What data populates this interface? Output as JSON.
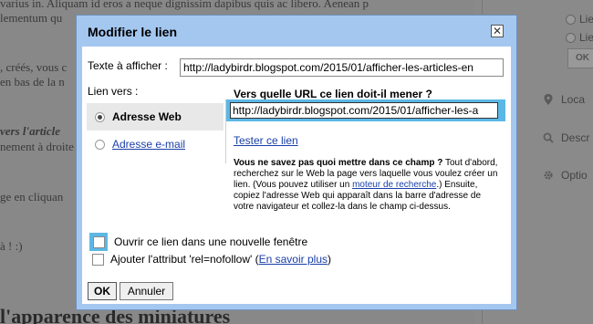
{
  "background": {
    "lines": [
      "varius in. Aliquam id eros a neque dignissim dapibus quis ac libero. Aenean p",
      "lementum qu",
      ", créés, vous c",
      "en bas de la n",
      "vers l'article",
      "nement à droite",
      "ge en cliquan",
      "à ! :)"
    ],
    "heading": "l'apparence des miniatures",
    "sidebar": {
      "radio_1": "Lie",
      "radio_2": "Lie",
      "ok": "OK",
      "items": [
        {
          "icon": "location-icon",
          "label": "Loca"
        },
        {
          "icon": "search-icon",
          "label": "Descr"
        },
        {
          "icon": "gear-icon",
          "label": "Optio"
        }
      ]
    }
  },
  "dialog": {
    "title": "Modifier le lien",
    "close_glyph": "✕",
    "text_label": "Texte à afficher :",
    "text_value": "http://ladybirdr.blogspot.com/2015/01/afficher-les-articles-en",
    "link_to_label": "Lien vers :",
    "link_types": [
      {
        "label": "Adresse Web",
        "selected": true
      },
      {
        "label": "Adresse e-mail",
        "selected": false
      }
    ],
    "url_question": "Vers quelle URL ce lien doit-il mener ?",
    "url_value": "http://ladybirdr.blogspot.com/2015/01/afficher-les-a",
    "test_link": "Tester ce lien",
    "help": {
      "bold": "Vous ne savez pas quoi mettre dans ce champ ?",
      "text_1": " Tout d'abord, recherchez sur le Web la page vers laquelle vous voulez créer un lien. (Vous pouvez utiliser un ",
      "link": "moteur de recherche",
      "text_2": ".) Ensuite, copiez l'adresse Web qui apparaît dans la barre d'adresse de votre navigateur et collez-la dans le champ ci-dessus."
    },
    "new_window_label": "Ouvrir ce lien dans une nouvelle fenêtre",
    "nofollow_label": "Ajouter l'attribut 'rel=nofollow' (",
    "nofollow_link": "En savoir plus",
    "nofollow_close": ")",
    "ok_label": "OK",
    "cancel_label": "Annuler"
  }
}
